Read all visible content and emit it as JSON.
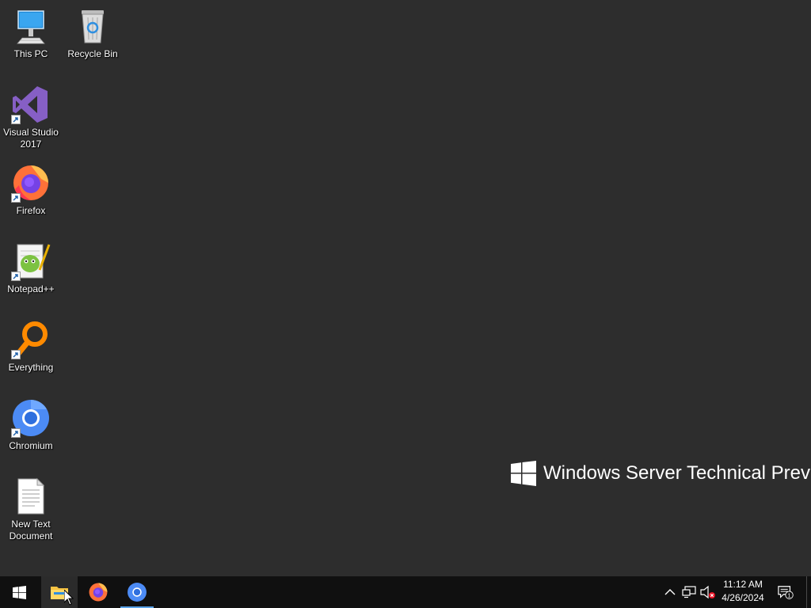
{
  "desktop": {
    "background_color": "#2d2d2d",
    "icons": [
      {
        "label": "This PC",
        "icon": "this-pc-icon",
        "shortcut": false
      },
      {
        "label": "Recycle Bin",
        "icon": "recycle-bin-icon",
        "shortcut": false
      },
      {
        "label": "Visual Studio 2017",
        "icon": "visual-studio-icon",
        "shortcut": true
      },
      {
        "label": "Firefox",
        "icon": "firefox-icon",
        "shortcut": true
      },
      {
        "label": "Notepad++",
        "icon": "notepad-plus-plus-icon",
        "shortcut": true
      },
      {
        "label": "Everything",
        "icon": "everything-search-icon",
        "shortcut": true
      },
      {
        "label": "Chromium",
        "icon": "chromium-icon",
        "shortcut": true
      },
      {
        "label": "New Text Document",
        "icon": "text-document-icon",
        "shortcut": false
      }
    ],
    "watermark": "Windows Server Technical Preview"
  },
  "taskbar": {
    "background_color": "#101010",
    "start_button": "windows-start-icon",
    "pinned": [
      {
        "name": "File Explorer",
        "icon": "file-explorer-icon",
        "state": "hovered"
      },
      {
        "name": "Firefox",
        "icon": "firefox-icon",
        "state": "idle"
      },
      {
        "name": "Chromium",
        "icon": "chromium-icon",
        "state": "running"
      }
    ],
    "tray": {
      "icons": [
        "chevron-up-icon",
        "network-icon",
        "volume-muted-icon"
      ],
      "time": "11:12 AM",
      "date": "4/26/2024",
      "notification_count": "1"
    }
  }
}
